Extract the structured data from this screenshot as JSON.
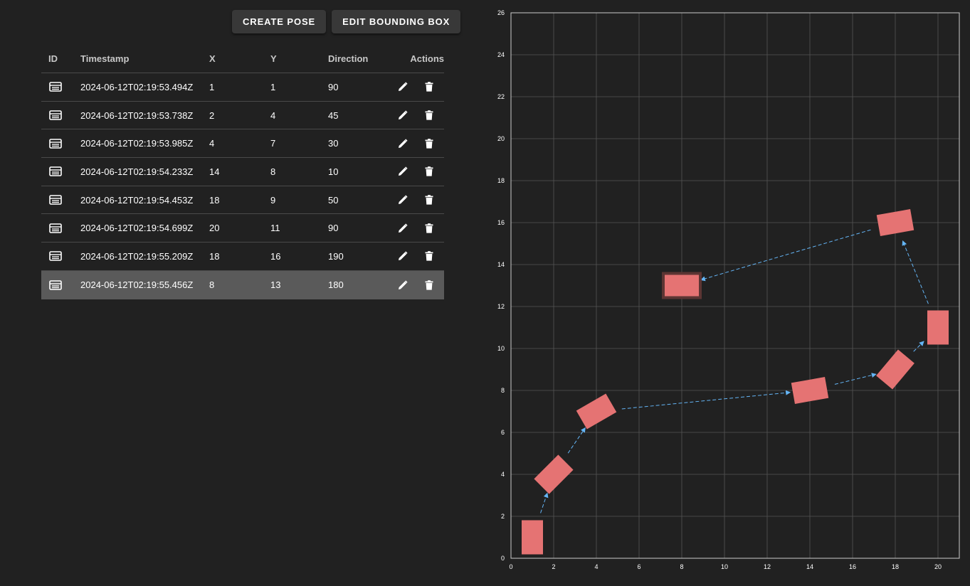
{
  "toolbar": {
    "create_pose_label": "CREATE POSE",
    "edit_bbox_label": "EDIT BOUNDING BOX"
  },
  "table": {
    "headers": {
      "id": "ID",
      "timestamp": "Timestamp",
      "x": "X",
      "y": "Y",
      "direction": "Direction",
      "actions": "Actions"
    },
    "selected_index": 7,
    "rows": [
      {
        "timestamp": "2024-06-12T02:19:53.494Z",
        "x": "1",
        "y": "1",
        "direction": "90"
      },
      {
        "timestamp": "2024-06-12T02:19:53.738Z",
        "x": "2",
        "y": "4",
        "direction": "45"
      },
      {
        "timestamp": "2024-06-12T02:19:53.985Z",
        "x": "4",
        "y": "7",
        "direction": "30"
      },
      {
        "timestamp": "2024-06-12T02:19:54.233Z",
        "x": "14",
        "y": "8",
        "direction": "10"
      },
      {
        "timestamp": "2024-06-12T02:19:54.453Z",
        "x": "18",
        "y": "9",
        "direction": "50"
      },
      {
        "timestamp": "2024-06-12T02:19:54.699Z",
        "x": "20",
        "y": "11",
        "direction": "90"
      },
      {
        "timestamp": "2024-06-12T02:19:55.209Z",
        "x": "18",
        "y": "16",
        "direction": "190"
      },
      {
        "timestamp": "2024-06-12T02:19:55.456Z",
        "x": "8",
        "y": "13",
        "direction": "180"
      }
    ]
  },
  "icons": {
    "row": "table-rows-icon",
    "edit": "pencil-icon",
    "delete": "trash-icon"
  },
  "colors": {
    "pose_fill": "#e57373",
    "path_line": "#64b5f6",
    "grid": "#555555",
    "selection": "#5c3533"
  },
  "chart_data": {
    "type": "scatter",
    "x_ticks": [
      "0",
      "2",
      "4",
      "6",
      "8",
      "10",
      "12",
      "14",
      "16",
      "18",
      "20"
    ],
    "y_ticks": [
      "0",
      "2",
      "4",
      "6",
      "8",
      "10",
      "12",
      "14",
      "16",
      "18",
      "20",
      "22",
      "24",
      "26"
    ],
    "xlim": [
      0,
      21
    ],
    "ylim": [
      0,
      26
    ],
    "grid": true,
    "points": [
      {
        "x": 1,
        "y": 1,
        "direction": 90
      },
      {
        "x": 2,
        "y": 4,
        "direction": 45
      },
      {
        "x": 4,
        "y": 7,
        "direction": 30
      },
      {
        "x": 14,
        "y": 8,
        "direction": 10
      },
      {
        "x": 18,
        "y": 9,
        "direction": 50
      },
      {
        "x": 20,
        "y": 11,
        "direction": 90
      },
      {
        "x": 18,
        "y": 16,
        "direction": 190
      },
      {
        "x": 8,
        "y": 13,
        "direction": 180
      }
    ],
    "selected_point": 7
  }
}
